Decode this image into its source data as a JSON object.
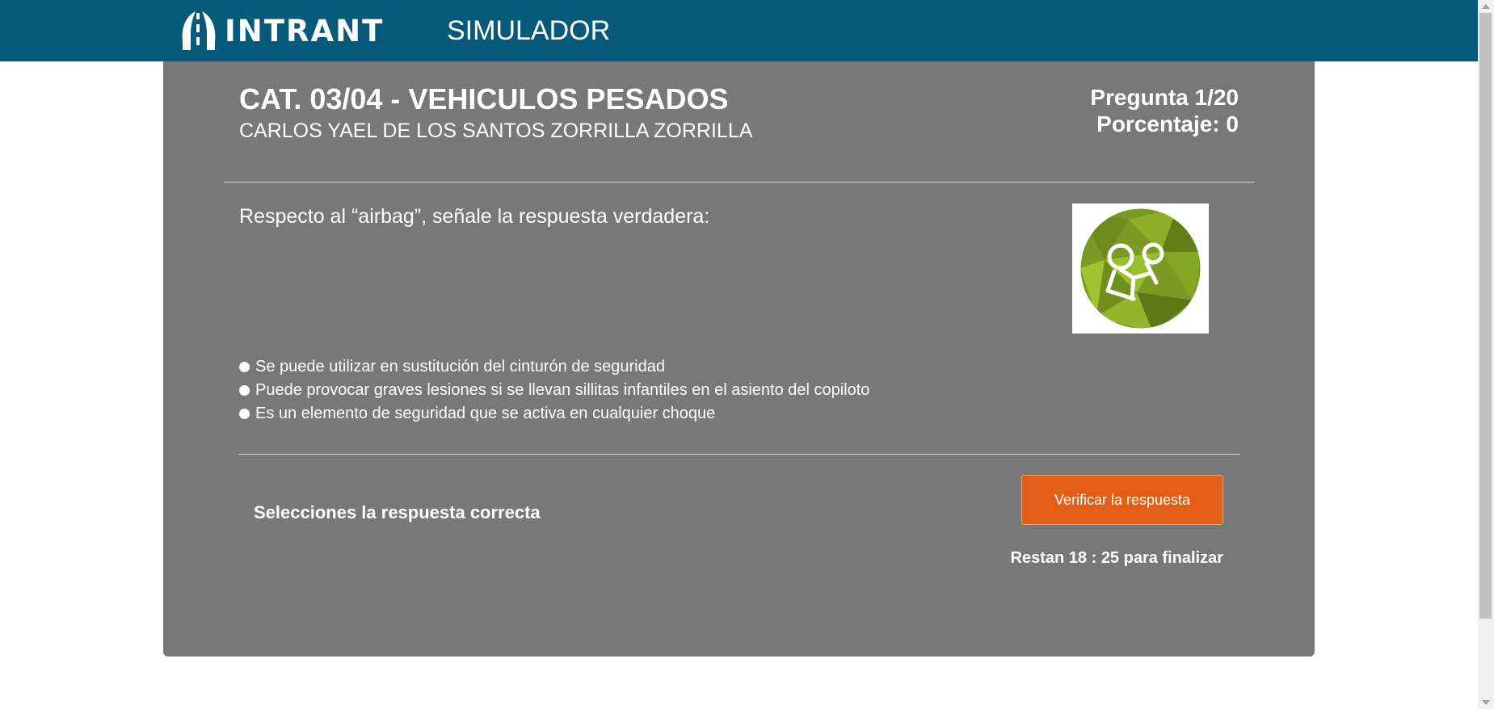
{
  "header": {
    "logo_text": "INTRANT",
    "app_title": "SIMULADOR",
    "brand_color": "#045a78"
  },
  "exam": {
    "title": "CAT. 03/04 - VEHICULOS PESADOS",
    "student_name": "CARLOS YAEL DE LOS SANTOS ZORRILLA ZORRILLA",
    "question_counter": "Pregunta 1/20",
    "score": "Porcentaje: 0"
  },
  "question": {
    "text": "Respecto al “airbag”, señale la respuesta verdadera:",
    "image_icon": "airbag-warning-icon",
    "options": [
      "Se puede utilizar en sustitución del cinturón de seguridad",
      "Puede provocar graves lesiones si se llevan sillitas infantiles en el asiento del copiloto",
      "Es un elemento de seguridad que se activa en cualquier choque"
    ]
  },
  "footer": {
    "instruction": "Selecciones la respuesta correcta",
    "verify_button": "Verificar la respuesta",
    "verify_button_color": "#e35e17",
    "timer": "Restan 18 : 25 para finalizar"
  },
  "colors": {
    "panel": "#787878"
  }
}
